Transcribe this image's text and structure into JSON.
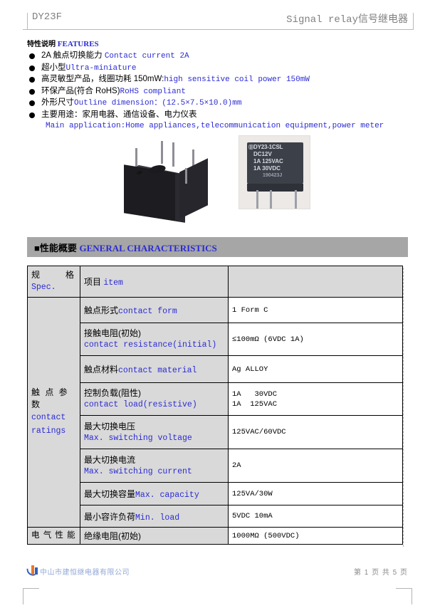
{
  "header": {
    "model": "DY23F",
    "title_en": "Signal relay",
    "title_cn": "信号继电器"
  },
  "features": {
    "heading_cn": "特性说明",
    "heading_en": "FEATURES",
    "items": [
      {
        "cn": "2A 触点切换能力 ",
        "en": "Contact current 2A"
      },
      {
        "cn": "超小型",
        "en": "Ultra-miniature"
      },
      {
        "cn": "高灵敏型产品，线圈功耗 150mW:",
        "en": "high sensitive coil power 150mW"
      },
      {
        "cn": "环保产品(符合 RoHS)",
        "en": "RoHS compliant"
      },
      {
        "cn": "外形尺寸",
        "en": "Outline dimension：(12.5×7.5×10.0)mm"
      },
      {
        "cn": "主要用途：家用电器、通信设备、电力仪表",
        "en": ""
      }
    ],
    "sub_line": "Main application:Home appliances,telecommunication equipment,power meter"
  },
  "product_photos": {
    "photo_1_name": "relay-isometric-photo",
    "photo_2_name": "relay-front-label-photo",
    "label": {
      "brand_mark": "Ⓓ",
      "model": "DY23-1CSL",
      "coil": "DC12V",
      "rating_1": "1A   125VAC",
      "rating_2": "1A   30VDC",
      "lot_code": "190423J"
    }
  },
  "section": {
    "marker": "■",
    "heading_cn": "性能概要",
    "heading_en": "GENERAL CHARACTERISTICS"
  },
  "spec_table": {
    "header": {
      "col1_cn": "规　　　格",
      "col1_en": "Spec.",
      "col2_cn": "项目 ",
      "col2_en": "item",
      "col3": ""
    },
    "group_1": {
      "cn": "触 点 参 数",
      "en_line1": "contact",
      "en_line2": "ratings"
    },
    "group_2": {
      "cn": "电 气 性 能"
    },
    "rows": [
      {
        "item_cn": "触点形式",
        "item_en": "contact form",
        "stacked": false,
        "value": "1 Form C"
      },
      {
        "item_cn": "接触电阻(初始)",
        "item_en": "contact resistance(initial)",
        "stacked": true,
        "value": "≤100mΩ (6VDC 1A)"
      },
      {
        "item_cn": "触点材料",
        "item_en": "contact material",
        "stacked": false,
        "value": "Ag ALLOY"
      },
      {
        "item_cn": "控制负载(阻性)",
        "item_en": "contact load(resistive)",
        "stacked": true,
        "value_line1": "1A   30VDC",
        "value_line2": "1A  125VAC"
      },
      {
        "item_cn": "最大切换电压",
        "item_en": "Max. switching voltage",
        "stacked": true,
        "value": "125VAC/60VDC"
      },
      {
        "item_cn": "最大切换电流",
        "item_en": "Max. switching current",
        "stacked": true,
        "value": "2A"
      },
      {
        "item_cn": "最大切换容量",
        "item_en": "Max. capacity",
        "stacked": false,
        "value": "125VA/30W"
      },
      {
        "item_cn": "最小容许负荷",
        "item_en": "Min. load",
        "stacked": false,
        "value": "5VDC   10mA"
      },
      {
        "item_cn": "绝缘电阻(初始)",
        "item_en": "",
        "stacked": false,
        "value": "1000MΩ (500VDC)"
      }
    ]
  },
  "footer": {
    "company": "中山市建恒继电器有限公司",
    "page_label": "第 1 页 共 5 页"
  }
}
